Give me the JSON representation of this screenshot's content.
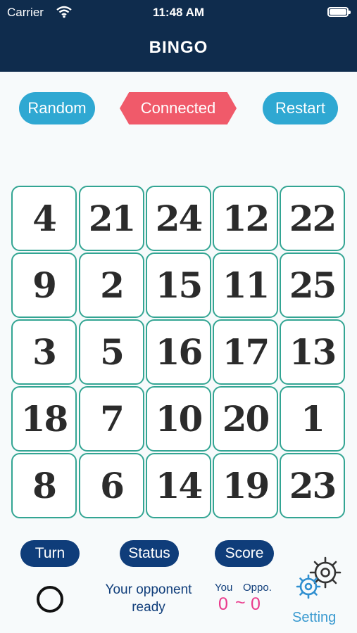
{
  "status_bar": {
    "carrier": "Carrier",
    "time": "11:48 AM"
  },
  "header": {
    "title": "BINGO"
  },
  "controls": {
    "random": "Random",
    "connected": "Connected",
    "restart": "Restart"
  },
  "grid": [
    [
      "4",
      "21",
      "24",
      "12",
      "22"
    ],
    [
      "9",
      "2",
      "15",
      "11",
      "25"
    ],
    [
      "3",
      "5",
      "16",
      "17",
      "13"
    ],
    [
      "18",
      "7",
      "10",
      "20",
      "1"
    ],
    [
      "8",
      "6",
      "14",
      "19",
      "23"
    ]
  ],
  "footer": {
    "turn_label": "Turn",
    "status_label": "Status",
    "score_label": "Score",
    "status_line1": "Your opponent",
    "status_line2": "ready",
    "you_label": "You",
    "oppo_label": "Oppo.",
    "you_score": "0",
    "separator": "~",
    "oppo_score": "0",
    "setting_label": "Setting"
  },
  "colors": {
    "header_bg": "#0f2c4d",
    "pill_blue": "#2fa8d2",
    "connected_red": "#f05a6a",
    "cell_border": "#33a593",
    "navy": "#0f3d7a",
    "score_pink": "#ea3a8c"
  },
  "icons": {
    "wifi": "wifi-icon",
    "battery": "battery-icon",
    "turn": "circle-icon",
    "setting": "gear-icon"
  }
}
